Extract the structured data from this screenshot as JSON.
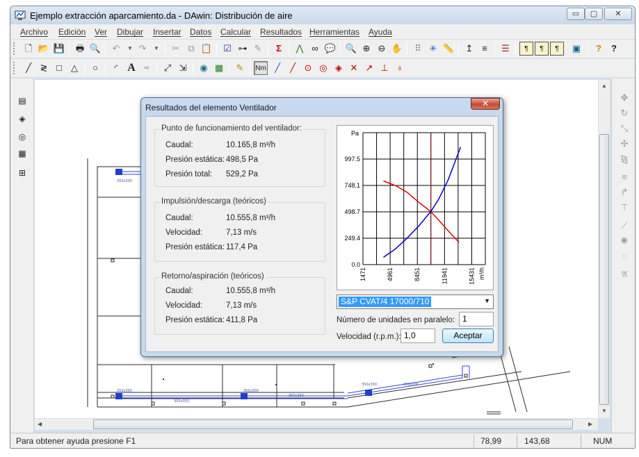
{
  "window": {
    "title": "Ejemplo extracción aparcamiento.da - DAwin: Distribución de aire",
    "controls": {
      "minimize": "▭",
      "maximize": "▢",
      "close": "✕"
    }
  },
  "menu": [
    "Archivo",
    "Edición",
    "Ver",
    "Dibujar",
    "Insertar",
    "Datos",
    "Calcular",
    "Resultados",
    "Herramientas",
    "Ayuda"
  ],
  "toolbar": {
    "sigma": "Σ",
    "text_tool": "A",
    "nm_button": "Nm",
    "help": "?",
    "whats_this": "?"
  },
  "drawing": {
    "duct_labels": [
      "350x300",
      "350x300",
      "350x300",
      "300x350",
      "350x350",
      "350x300",
      "350x300"
    ]
  },
  "dialog": {
    "title": "Resultados del elemento Ventilador",
    "close": "✕",
    "groups": [
      {
        "title": "Punto de funcionamiento del ventilador:",
        "rows": [
          {
            "label": "Caudal:",
            "value": "10.165,8 m³/h"
          },
          {
            "label": "Presión estática:",
            "value": "498,5 Pa"
          },
          {
            "label": "Presión total:",
            "value": "529,2 Pa"
          }
        ]
      },
      {
        "title": "Impulsión/descarga (teóricos)",
        "rows": [
          {
            "label": "Caudal:",
            "value": "10.555,8 m³/h"
          },
          {
            "label": "Velocidad:",
            "value": "7,13 m/s"
          },
          {
            "label": "Presión estática:",
            "value": "117,4 Pa"
          }
        ]
      },
      {
        "title": "Retorno/aspiración (teóricos)",
        "rows": [
          {
            "label": "Caudal:",
            "value": "10.555,8 m³/h"
          },
          {
            "label": "Velocidad:",
            "value": "7,13 m/s"
          },
          {
            "label": "Presión estática:",
            "value": "411,8 Pa"
          }
        ]
      }
    ],
    "fan_model": "S&P CVAT/4 17000/710",
    "units_label": "Número de unidades en paralelo:",
    "units_value": "1",
    "speed_label": "Velocidad (r.p.m.):",
    "speed_value": "1,0",
    "accept": "Aceptar"
  },
  "status": {
    "help": "Para obtener ayuda presione F1",
    "x": "78,99",
    "y": "143,68",
    "num": "NUM"
  },
  "colors": {
    "fan_curve": "#e00000",
    "system_curve": "#0000c8",
    "operating_line": "#c00000",
    "selection": "#3399ff"
  },
  "chart_data": {
    "type": "line",
    "ylabel": "Pa",
    "xlabel": "m³/h",
    "x_ticks": [
      "1471",
      "4961",
      "8451",
      "11941",
      "15431"
    ],
    "y_ticks": [
      "0.0",
      "249.4",
      "498.7",
      "748.1",
      "997.5"
    ],
    "xlim": [
      1471,
      17176
    ],
    "ylim": [
      0,
      1247
    ],
    "grid": true,
    "series": [
      {
        "role": "fan",
        "color": "#e00000",
        "x": [
          4100,
          5700,
          7200,
          8450,
          9500,
          10200,
          11200,
          12400,
          13800
        ],
        "y": [
          790,
          745,
          680,
          600,
          540,
          498.5,
          420,
          320,
          210
        ]
      },
      {
        "role": "system",
        "color": "#0000c8",
        "x": [
          4100,
          5500,
          7000,
          8700,
          9700,
          10166,
          11200,
          12400,
          14000
        ],
        "y": [
          70,
          140,
          240,
          370,
          460,
          498.5,
          620,
          800,
          1110
        ]
      }
    ],
    "operating_point": {
      "x": 10165.8,
      "y": 498.5
    }
  }
}
